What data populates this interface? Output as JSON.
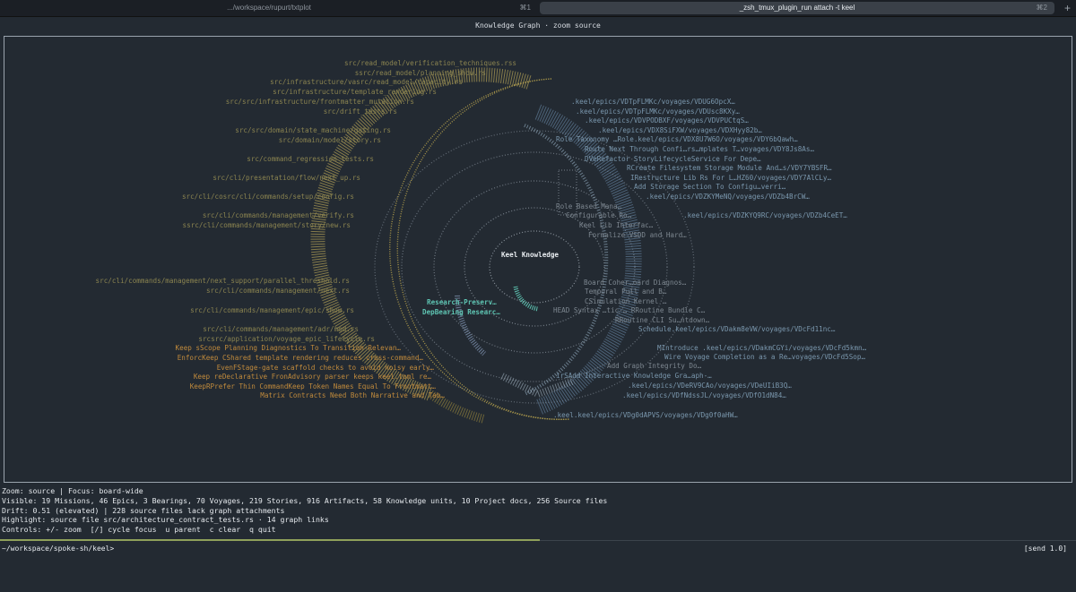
{
  "tabs": [
    {
      "title": ".../workspace/rupurt/txtplot",
      "shortcut": "⌘1"
    },
    {
      "title": "_zsh_tmux_plugin_run attach -t keel",
      "shortcut": "⌘2"
    }
  ],
  "new_tab": "+",
  "header": "Knowledge Graph · zoom source",
  "center_label": "Keel Knowledge",
  "left_labels": [
    "src/read_model/verification_techniques.rss",
    "ssrc/read_model/planning_show.rs",
    "src/infrastructure/vasrc/read_model/capacity.rs",
    "src/infrastructure/template_rendering.rs",
    "src/src/infrastructure/frontmatter_mutation.rs",
    "src/drift_tests.rs",
    "src/src/domain/state_machine/gating.rs",
    "src/domain/model/story.rs",
    "src/command_regression_tests.rs",
    "src/cli/presentation/flow/next_up.rs",
    "src/cli/cosrc/cli/commands/setup/config.rs",
    "src/cli/commands/management/verify.rs",
    "ssrc/cli/commands/management/story/new.rs",
    "src/cli/commands/management/next_support/parallel_threshold.rs",
    "src/cli/commands/management/next.rs",
    "src/cli/commands/management/epic/show.rs",
    "src/cli/commands/management/adr/mod.rs",
    "srcsrc/application/voyage_epic_lifecycle.rs",
    "Keep sScope Planning Diagnostics To Transition-Relevan…",
    "EnforcKeep CShared template rendering reduces cross-command…",
    "EvenFStage-gate scaffold checks to avoid noisy early…",
    "Keep reDeclarative FronAdvisory parser keeps keel.toml re…",
    "KeepRPrefer Thin CommandKeep Token Names Equal To Frontmatt…",
    "Matrix Contracts Need Both Narrative and Tab…"
  ],
  "right_labels": [
    ".keel/epics/VDTpFLMKc/voyages/VDUG6OpcX…",
    ".keel/epics/VDTpFLMKc/voyages/VDUsc8KXy…",
    ".keel/epics/VDVPODBXF/voyages/VDVPUCtqS…",
    ".keel/epics/VDX8SiFXW/voyages/VDXHyy82b…",
    "Role Taxonomy …Role.keel/epics/VDX8U7W6O/voyages/VDY6bQawh…",
    "Route Next Through Confi…rs…mplates T…voyages/VDY8Js8As…",
    "DVeRefactor StoryLifecycleService For Depe…",
    "RCreate Filesystem Storage Module And…s/VDY7YBSFR…",
    "IRestructure Lib Rs For L…HZ60/voyages/VDY7AlCLy…",
    "Add Storage Section To Configu…verri…",
    ".keel/epics/VDZKYMeNQ/voyages/VDZb4BrCW…",
    ".keel/epics/VDZKYQ9RC/voyages/VDZb4CeET…",
    "Role Based Mana…",
    "Configurable Ro…",
    "Keel Lib Interfac…",
    "Formalize VSDD and Hard…",
    "Board Coher…oard Diagnos…",
    "Temporal Pull and B…",
    "CSimulation Kernel …",
    "HEAD Syntax …tic  …  RRoutine Bundle C…",
    "RRoutine CLI Su…ntdown…",
    "Schedule.keel/epics/VDakm8eVW/voyages/VDcFd11nc…",
    "MIntroduce .keel/epics/VDakmCGYi/voyages/VDcFd5kmn…",
    "Wire Voyage Completion as a Re…voyages/VDcFd5Sop…",
    "Add Graph Integrity Do…",
    "irSAdd Interactive Knowledge Gra…aph-…",
    ".keel/epics/VDeRV9CAo/voyages/VDeUIiB3Q…",
    ".keel/epics/VDfNdssJL/voyages/VDfO1dN84…",
    ".keel.keel/epics/VDg0dAPVS/voyages/VDg0f0aHW…"
  ],
  "highlight_labels": [
    "Research-Preserv…",
    "DepBearing Researc…"
  ],
  "status": {
    "zoom": "Zoom: source | Focus: board-wide",
    "visible": "Visible: 19 Missions, 46 Epics, 3 Bearings, 70 Voyages, 219 Stories, 916 Artifacts, 58 Knowledge units, 10 Project docs, 256 Source files",
    "drift": "Drift: 0.51 (elevated) | 228 source files lack graph attachments",
    "highlight": "Highlight: source file src/architecture_contract_tests.rs · 14 graph links",
    "controls": "Controls: +/- zoom  [/] cycle focus  u parent  c clear  q quit"
  },
  "prompt": "~/workspace/spoke-sh/keel>",
  "send": "[send 1.0]",
  "colors": {
    "background": "#232a32",
    "source_label": "#8b8450",
    "knowledge_label": "#c08a3c",
    "arc_yellow": "#c8b050",
    "voyage_label": "#7a97ad",
    "inner_label": "#7d8790",
    "highlight_teal": "#5ec4b2",
    "panel_border": "#9aa3ad"
  }
}
